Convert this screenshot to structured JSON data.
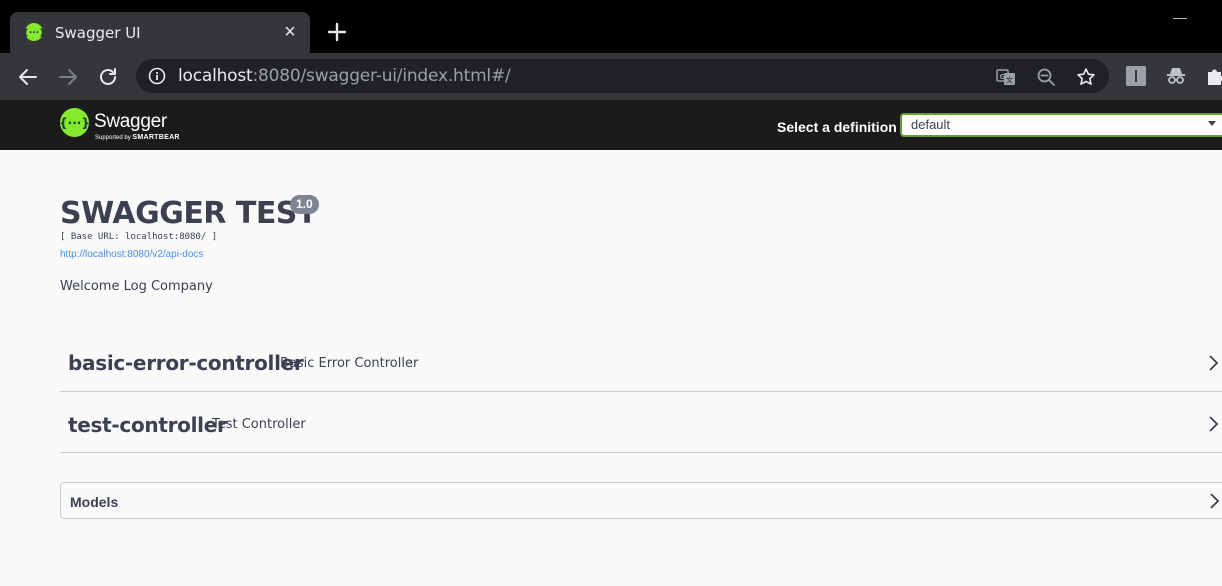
{
  "browser": {
    "tab_title": "Swagger UI",
    "tab_close": "×",
    "url_host": "localhost",
    "url_rest": ":8080/swagger-ui/index.html#/"
  },
  "swagger": {
    "logo_text": "Swagger",
    "logo_sub_prefix": "Supported by ",
    "logo_sub_brand": "SMARTBEAR",
    "definition_label": "Select a definition",
    "definition_value": "default",
    "title": "SWAGGER TEST",
    "version": "1.0",
    "base_url": "[ Base URL: localhost:8080/ ]",
    "api_docs_link": "http://localhost:8080/v2/api-docs",
    "description": "Welcome Log Company",
    "tags": [
      {
        "name": "basic-error-controller",
        "description": "Basic Error Controller"
      },
      {
        "name": "test-controller",
        "description": "Test Controller"
      }
    ],
    "models_label": "Models"
  },
  "colors": {
    "swagger_green": "#85ea2d",
    "topbar_bg": "#1b1b1b",
    "text": "#3b4151",
    "link": "#4990e2",
    "chrome_dark": "#35363a"
  },
  "icons": [
    "swagger-favicon",
    "close-icon",
    "plus-icon",
    "back-arrow-icon",
    "forward-arrow-icon",
    "reload-icon",
    "info-icon",
    "translate-icon",
    "zoom-out-icon",
    "star-icon",
    "extension-i-icon",
    "incognito-icon",
    "puzzle-icon",
    "chevron-right-icon"
  ]
}
